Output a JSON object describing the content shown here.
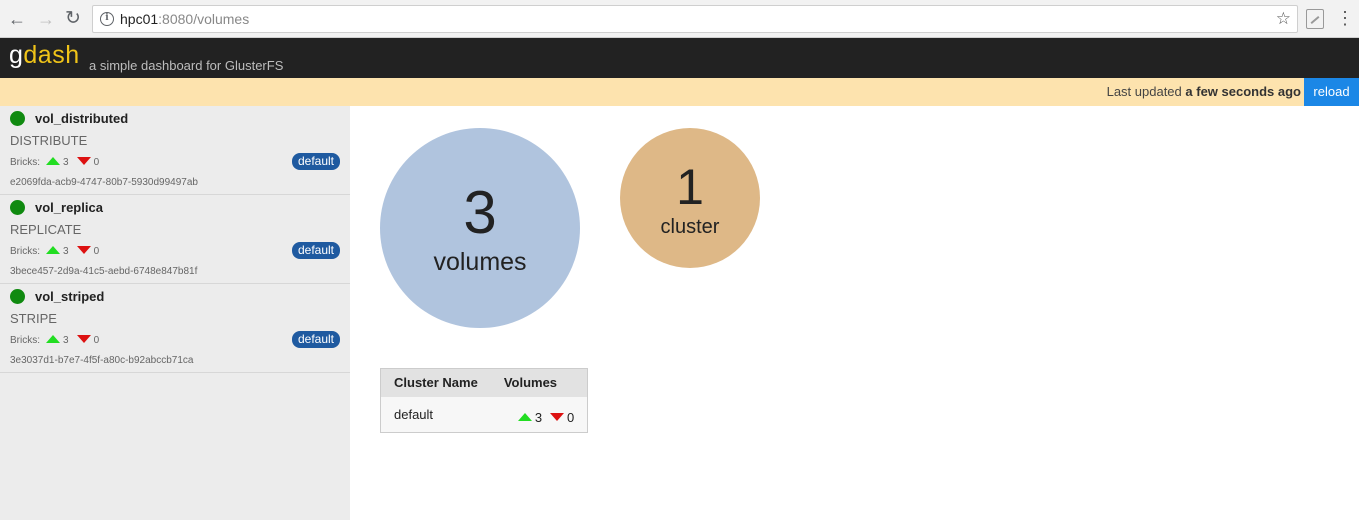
{
  "browser": {
    "url_host": "hpc01",
    "url_rest": ":8080/volumes"
  },
  "header": {
    "logo_part1": "g",
    "logo_part2": "dash",
    "tagline": "a simple dashboard for GlusterFS"
  },
  "status": {
    "last_updated_prefix": "Last updated",
    "last_updated_value": "a few seconds ago",
    "reload_label": "reload"
  },
  "volumes": [
    {
      "name": "vol_distributed",
      "type": "DISTRIBUTE",
      "bricks_label": "Bricks:",
      "bricks_up": "3",
      "bricks_down": "0",
      "cluster": "default",
      "id": "e2069fda-acb9-4747-80b7-5930d99497ab"
    },
    {
      "name": "vol_replica",
      "type": "REPLICATE",
      "bricks_label": "Bricks:",
      "bricks_up": "3",
      "bricks_down": "0",
      "cluster": "default",
      "id": "3bece457-2d9a-41c5-aebd-6748e847b81f"
    },
    {
      "name": "vol_striped",
      "type": "STRIPE",
      "bricks_label": "Bricks:",
      "bricks_up": "3",
      "bricks_down": "0",
      "cluster": "default",
      "id": "3e3037d1-b7e7-4f5f-a80c-b92abccb71ca"
    }
  ],
  "summary": {
    "volumes_count": "3",
    "volumes_label": "volumes",
    "cluster_count": "1",
    "cluster_label": "cluster"
  },
  "cluster_table": {
    "headers": [
      "Cluster Name",
      "Volumes"
    ],
    "rows": [
      {
        "name": "default",
        "up": "3",
        "down": "0"
      }
    ]
  },
  "colors": {
    "status_ok": "#108a10",
    "arrow_up": "#22dd22",
    "arrow_down": "#dd1111",
    "volumes_circle": "#b0c4de",
    "cluster_circle": "#deb887",
    "reload_button": "#1b87e6",
    "badge": "#1f5aa0"
  }
}
